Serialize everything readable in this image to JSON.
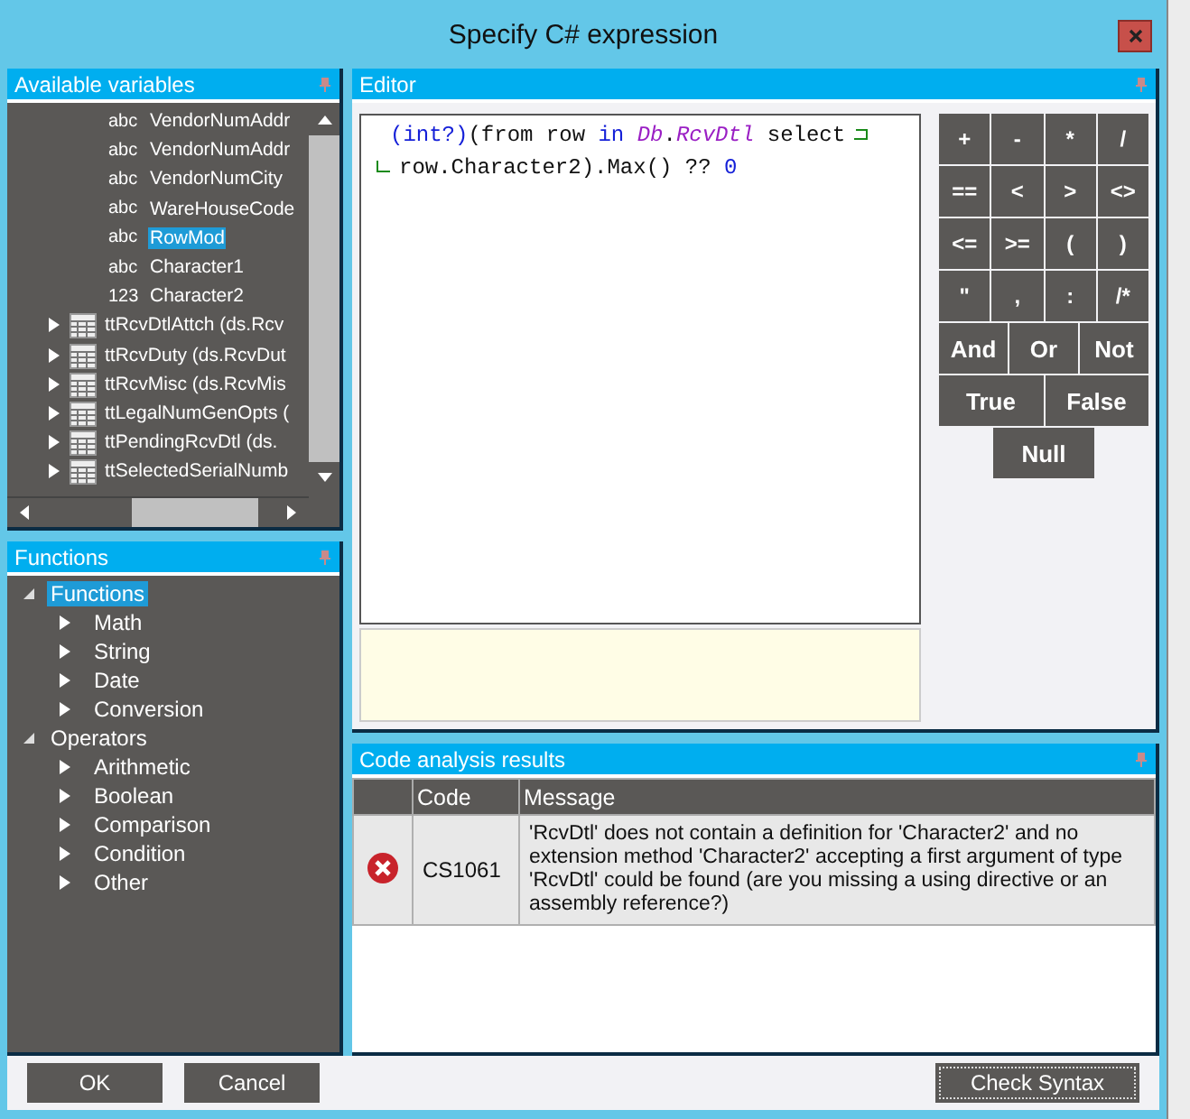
{
  "window": {
    "title": "Specify C# expression"
  },
  "variables_panel": {
    "title": "Available variables",
    "items": [
      {
        "kind": "field",
        "type": "abc",
        "name": "VendorNumAddr",
        "selected": false
      },
      {
        "kind": "field",
        "type": "abc",
        "name": "VendorNumAddr",
        "selected": false
      },
      {
        "kind": "field",
        "type": "abc",
        "name": "VendorNumCity",
        "selected": false
      },
      {
        "kind": "field",
        "type": "abc",
        "name": "WareHouseCode",
        "selected": false
      },
      {
        "kind": "field",
        "type": "abc",
        "name": "RowMod",
        "selected": true
      },
      {
        "kind": "field",
        "type": "abc",
        "name": "Character1",
        "selected": false
      },
      {
        "kind": "field",
        "type": "123",
        "name": "Character2",
        "selected": false
      },
      {
        "kind": "table",
        "name": "ttRcvDtlAttch (ds.Rcv",
        "selected": false
      },
      {
        "kind": "table",
        "name": "ttRcvDuty (ds.RcvDut",
        "selected": false
      },
      {
        "kind": "table",
        "name": "ttRcvMisc (ds.RcvMis",
        "selected": false
      },
      {
        "kind": "table",
        "name": "ttLegalNumGenOpts (",
        "selected": false
      },
      {
        "kind": "table",
        "name": "ttPendingRcvDtl (ds.",
        "selected": false
      },
      {
        "kind": "table",
        "name": "ttSelectedSerialNumb",
        "selected": false
      }
    ]
  },
  "functions_panel": {
    "title": "Functions",
    "items": [
      {
        "label": "Functions",
        "selected": true,
        "expanded": true,
        "children": [
          {
            "label": "Math",
            "selected": false,
            "expanded": false
          },
          {
            "label": "String",
            "selected": false,
            "expanded": false
          },
          {
            "label": "Date",
            "selected": false,
            "expanded": false
          },
          {
            "label": "Conversion",
            "selected": false,
            "expanded": false
          }
        ]
      },
      {
        "label": "Operators",
        "selected": false,
        "expanded": true,
        "children": [
          {
            "label": "Arithmetic",
            "selected": false,
            "expanded": false
          },
          {
            "label": "Boolean",
            "selected": false,
            "expanded": false
          },
          {
            "label": "Comparison",
            "selected": false,
            "expanded": false
          },
          {
            "label": "Condition",
            "selected": false,
            "expanded": false
          },
          {
            "label": "Other",
            "selected": false,
            "expanded": false
          }
        ]
      }
    ]
  },
  "editor": {
    "title": "Editor",
    "lines": [
      {
        "wrapped": true,
        "tokens": [
          {
            "kind": "keyword",
            "text": "(int?)"
          },
          {
            "kind": "plain",
            "text": "(from row "
          },
          {
            "kind": "keyword",
            "text": "in "
          },
          {
            "kind": "type",
            "text": "Db"
          },
          {
            "kind": "plain",
            "text": "."
          },
          {
            "kind": "type",
            "text": "RcvDtl"
          },
          {
            "kind": "plain",
            "text": " select"
          }
        ]
      },
      {
        "wrapped": false,
        "tokens": [
          {
            "kind": "plain",
            "text": "row.Character2).Max() ?? "
          },
          {
            "kind": "keyword",
            "text": "0"
          }
        ]
      }
    ],
    "operator_rows": [
      [
        "+",
        "-",
        "*",
        "/"
      ],
      [
        "==",
        "<",
        ">",
        "<>"
      ],
      [
        "<=",
        ">=",
        "(",
        ")"
      ],
      [
        "\"",
        ",",
        ":",
        "/*"
      ],
      [
        "And",
        "Or",
        "Not"
      ],
      [
        "True",
        "False"
      ],
      [
        "Null"
      ]
    ]
  },
  "results_panel": {
    "title": "Code analysis results",
    "columns": [
      "Code",
      "Message"
    ],
    "rows": [
      {
        "kind": "error",
        "code": "CS1061",
        "message": "'RcvDtl' does not contain a definition for 'Character2' and no extension method 'Character2' accepting a first argument of type 'RcvDtl' could be found (are you missing a using directive or an assembly reference?)"
      }
    ]
  },
  "buttons": {
    "ok": "OK",
    "cancel": "Cancel",
    "check": "Check Syntax"
  }
}
